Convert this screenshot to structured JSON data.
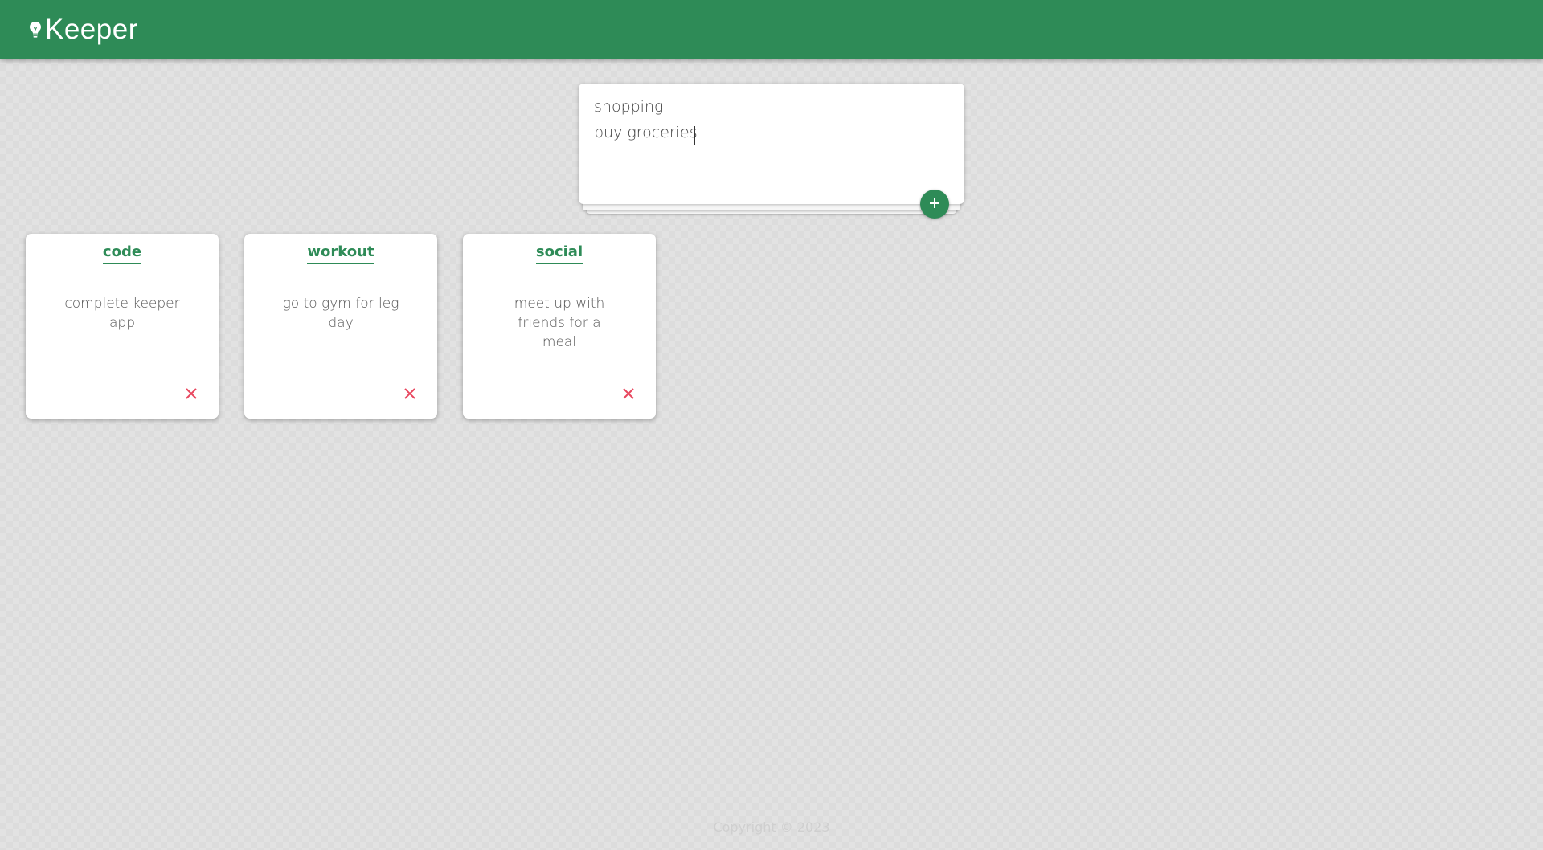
{
  "header": {
    "title": "Keeper",
    "icon": "lightbulb-icon",
    "background_color": "#2e8b57"
  },
  "create_note": {
    "title_value": "shopping",
    "content_value": "buy groceries",
    "add_icon": "plus-icon"
  },
  "notes": [
    {
      "title": "code",
      "content": "complete keeper app",
      "delete_icon": "close-icon"
    },
    {
      "title": "workout",
      "content": "go to gym for leg day",
      "delete_icon": "close-icon"
    },
    {
      "title": "social",
      "content": "meet up with friends for a meal",
      "delete_icon": "close-icon"
    }
  ],
  "footer": {
    "text": "Copyright © 2023"
  },
  "colors": {
    "accent": "#2e8b57",
    "delete": "#e8475f",
    "background": "#dcdcdc"
  }
}
